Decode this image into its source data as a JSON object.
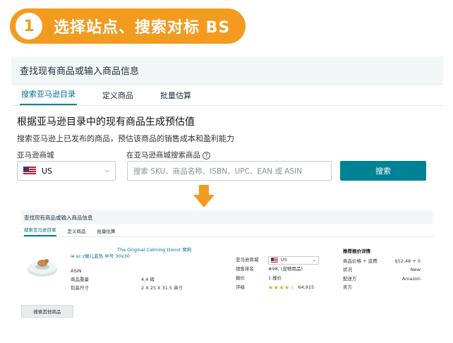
{
  "banner": {
    "number": "1",
    "text": "选择站点、搜索对标 BS"
  },
  "panel": {
    "header": "查找现有商品或输入商品信息",
    "tabs": [
      "搜索亚马逊目录",
      "定义商品",
      "批量估算"
    ],
    "section_title": "根据亚马逊目录中的现有商品生成预估值",
    "section_subtitle": "搜索亚马逊上已发布的商品，预估该商品的销售成本和盈利能力",
    "marketplace_label": "亚马逊商城",
    "search_label": "在亚马逊商城搜索商品",
    "marketplace_value": "US",
    "search_placeholder": "搜索 SKU、商品名称、ISBN、UPC、EAN 或 ASIN",
    "search_button": "搜索"
  },
  "panel2": {
    "header": "查找现有商品或输入商品信息",
    "tabs": [
      "搜索亚马逊目录",
      "定义商品",
      "批量估算"
    ],
    "product": {
      "title_line1": "The Original Calming Donut 窝狗",
      "title_line2": "ie sc·z娱儿蓝色 中号 30x30",
      "asin_label": "ASIN",
      "weight_label": "商品重量",
      "weight_value": "4.4 磅",
      "size_label": "包装尺寸",
      "size_value": "2 X 25 X 31.5 英寸"
    },
    "mid": {
      "marketplace_label": "亚马逊商城",
      "marketplace_value": "US",
      "rank_label": "销售排名",
      "rank_value": "#98, (宠物用品)",
      "offers_label": "报价",
      "offers_value": "1 报价",
      "reviews_label": "评级",
      "stars": "★★★★☆",
      "reviews_count": "64,915"
    },
    "right": {
      "title": "推荐报价详情",
      "price_label": "商品价格 + 运费",
      "price_value": "$52.48 + 0",
      "condition_label": "状况",
      "condition_value": "New",
      "fulfilled_label": "配送方",
      "fulfilled_value": "Amazon",
      "seller_label": "卖方"
    },
    "button": "搜索其他商品"
  },
  "colors": {
    "accent": "#f39b1f",
    "teal": "#008296",
    "star": "#f0a21b"
  }
}
